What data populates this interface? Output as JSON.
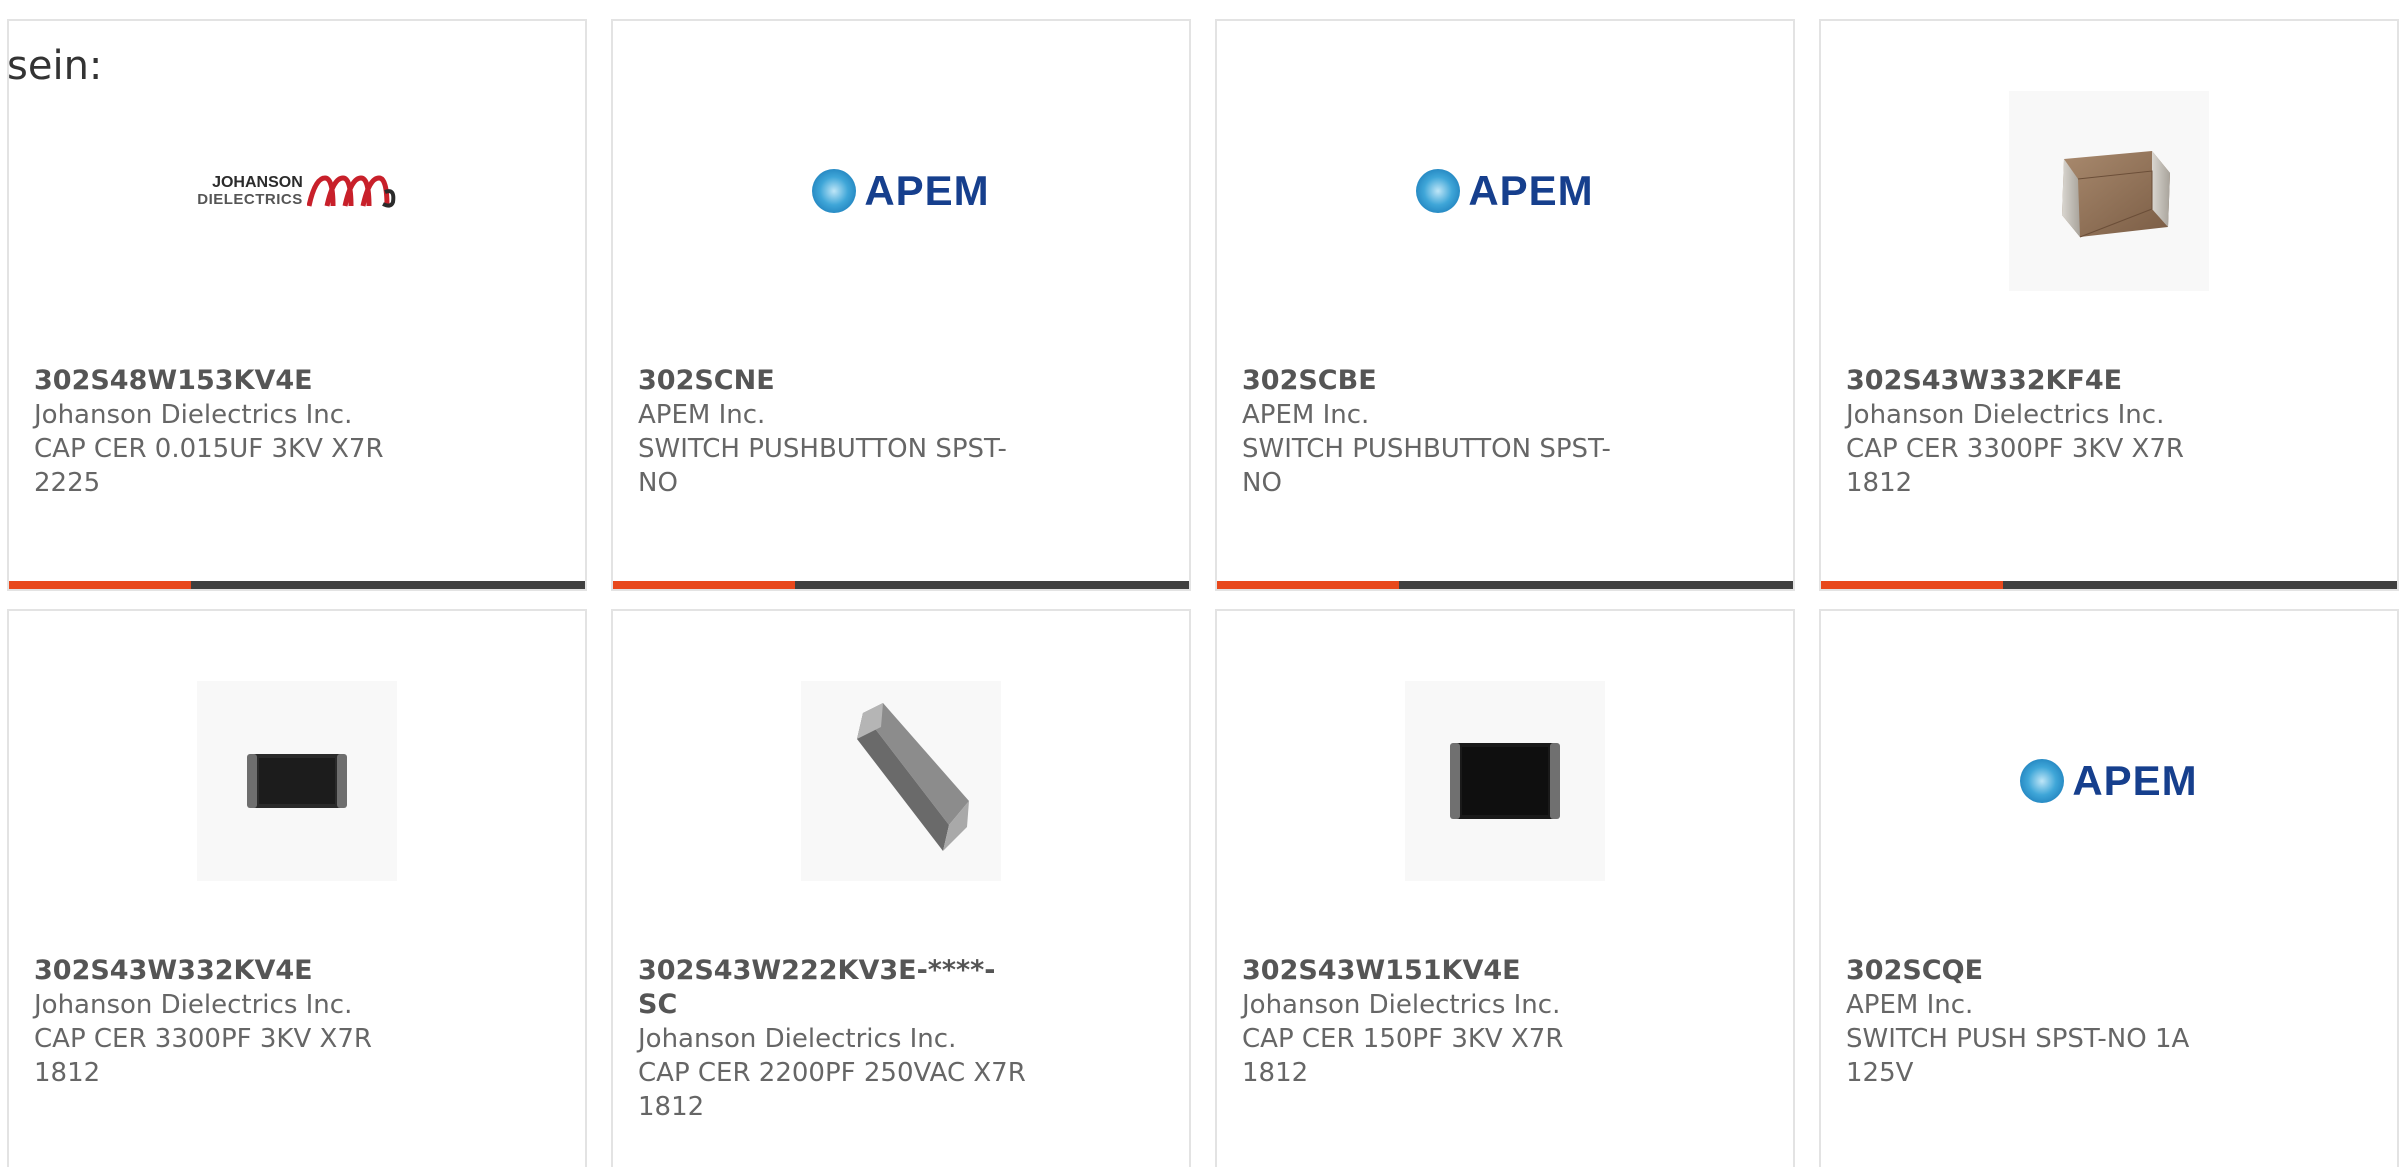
{
  "intro_text": "sein:",
  "products": [
    {
      "part_number": "302S48W153KV4E",
      "manufacturer": "Johanson Dielectrics Inc.",
      "description": "CAP CER 0.015UF 3KV X7R 2225",
      "image": "johanson-logo",
      "logo_line1": "JOHANSON",
      "logo_line2": "DIELECTRICS"
    },
    {
      "part_number": "302SCNE",
      "manufacturer": "APEM Inc.",
      "description": "SWITCH PUSHBUTTON SPST-NO",
      "image": "apem-logo",
      "logo_text": "APEM"
    },
    {
      "part_number": "302SCBE",
      "manufacturer": "APEM Inc.",
      "description": "SWITCH PUSHBUTTON SPST-NO",
      "image": "apem-logo",
      "logo_text": "APEM"
    },
    {
      "part_number": "302S43W332KF4E",
      "manufacturer": "Johanson Dielectrics Inc.",
      "description": "CAP CER 3300PF 3KV X7R 1812",
      "image": "brown-chip-capacitor"
    },
    {
      "part_number": "302S43W332KV4E",
      "manufacturer": "Johanson Dielectrics Inc.",
      "description": "CAP CER 3300PF 3KV X7R 1812",
      "image": "black-chip-capacitor"
    },
    {
      "part_number": "302S43W222KV3E-****-SC",
      "manufacturer": "Johanson Dielectrics Inc.",
      "description": "CAP CER 2200PF 250VAC X7R 1812",
      "image": "grey-chip-capacitor"
    },
    {
      "part_number": "302S43W151KV4E",
      "manufacturer": "Johanson Dielectrics Inc.",
      "description": "CAP CER 150PF 3KV X7R 1812",
      "image": "black-chip-capacitor"
    },
    {
      "part_number": "302SCQE",
      "manufacturer": "APEM Inc.",
      "description": "SWITCH PUSH SPST-NO 1A 125V",
      "image": "apem-logo",
      "logo_text": "APEM"
    }
  ],
  "colors": {
    "accent": "#e8481c",
    "bar": "#3f3f3f",
    "border": "#e3e3e3",
    "apem_blue": "#163f8d"
  }
}
